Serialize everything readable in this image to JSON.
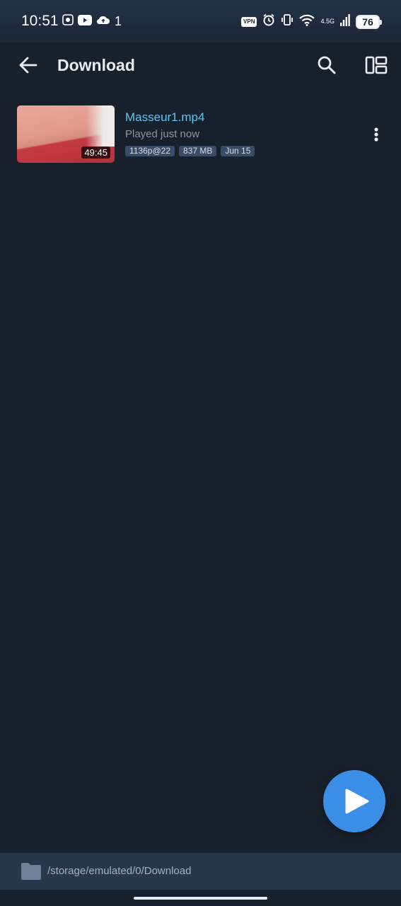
{
  "status_bar": {
    "time": "10:51",
    "notification_count": "1",
    "vpn_label": "VPN",
    "network_label": "4.5G",
    "battery": "76"
  },
  "app_bar": {
    "title": "Download",
    "back_icon": "arrow-left-icon",
    "search_icon": "search-icon",
    "layout_icon": "view-layout-icon"
  },
  "videos": [
    {
      "title": "Masseur1.mp4",
      "subtitle": "Played just now",
      "duration": "49:45",
      "tags": [
        "1136p@22",
        "837 MB",
        "Jun 15"
      ]
    }
  ],
  "fab": {
    "icon": "play-icon"
  },
  "path_bar": {
    "icon": "folder-icon",
    "path": "/storage/emulated/0/Download"
  },
  "colors": {
    "background": "#18202c",
    "title_accent": "#62c3f3",
    "fab": "#3b8ee6",
    "tag_bg": "#3a4c66"
  }
}
